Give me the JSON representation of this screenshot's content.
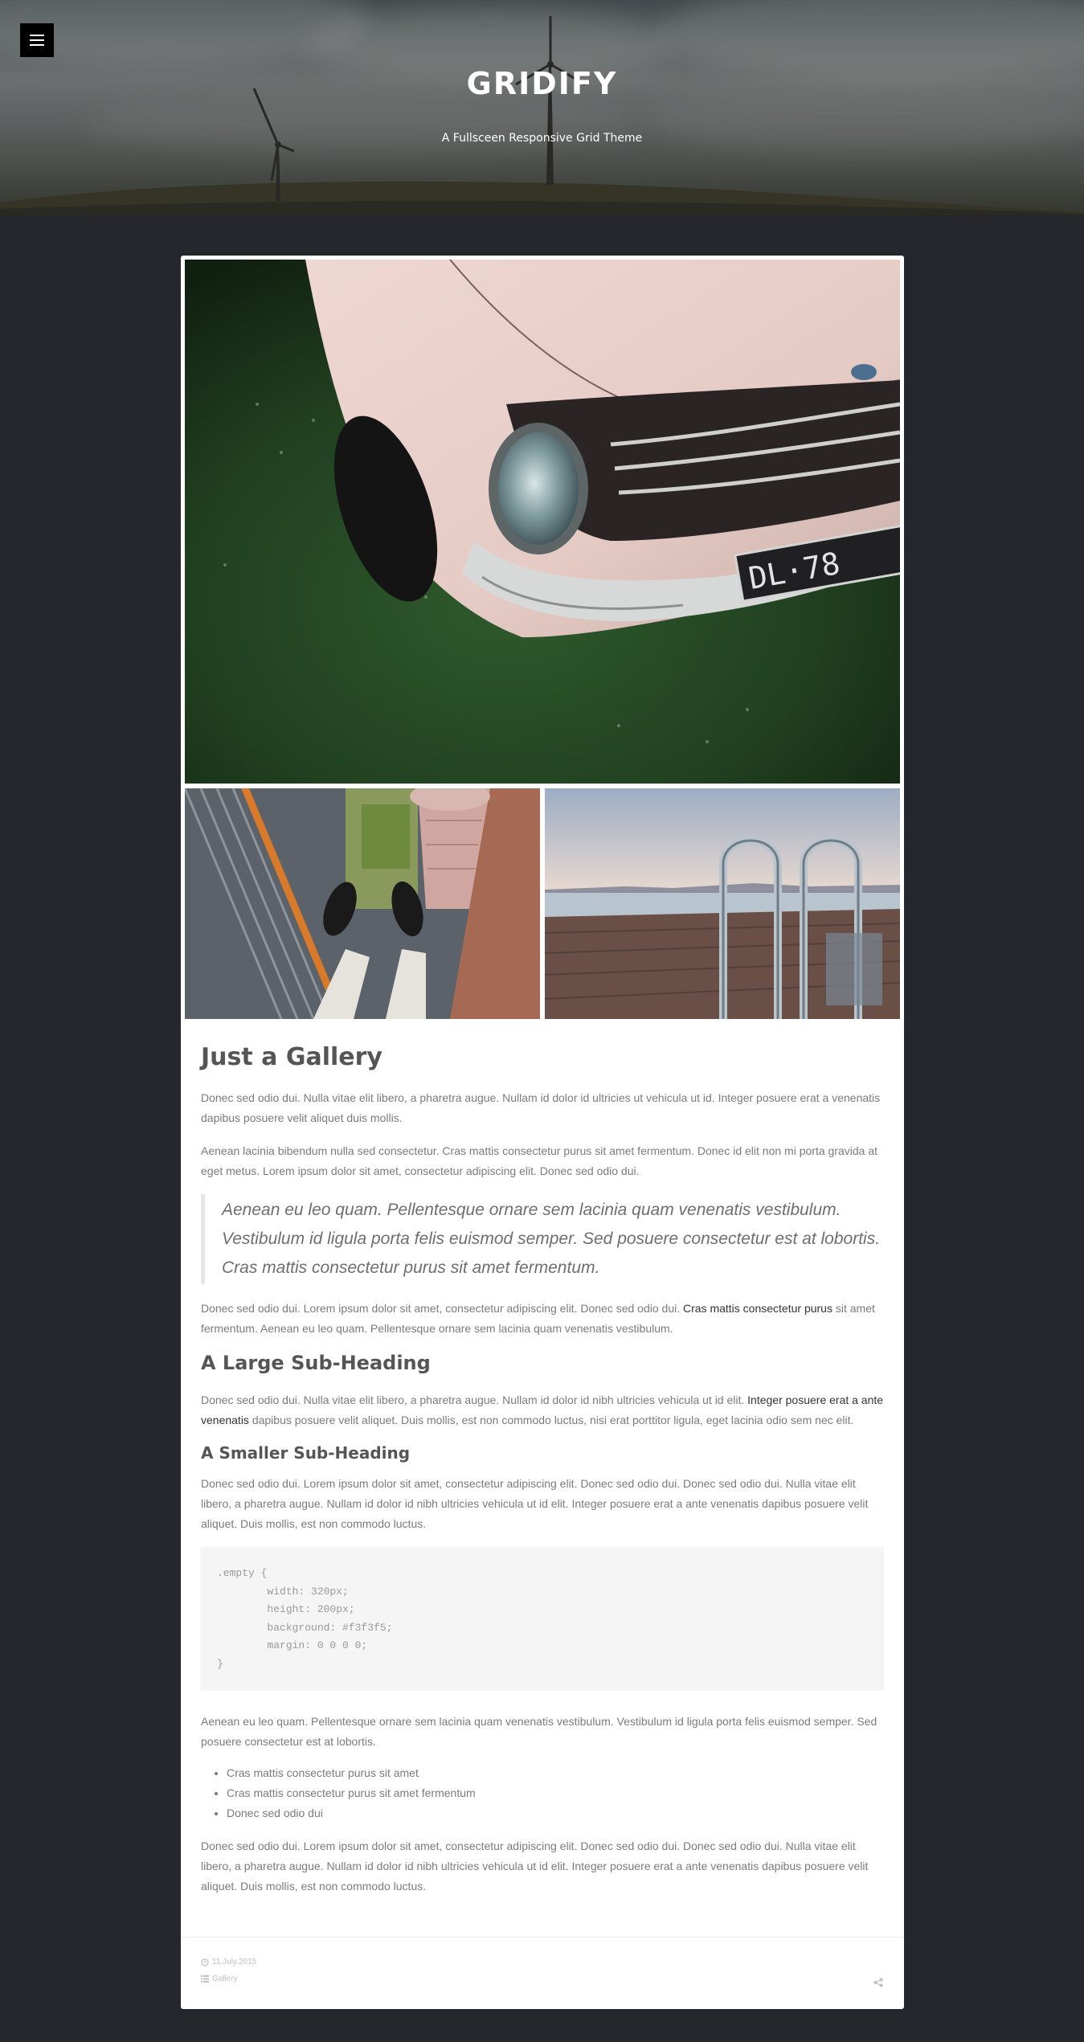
{
  "header": {
    "site_title": "GRIDIFY",
    "tagline": "A Fullsceen Responsive Grid Theme",
    "menu_icon": "hamburger-menu-icon"
  },
  "gallery": {
    "images": [
      {
        "name": "vintage-car-photo",
        "plate_text": "DL·78"
      },
      {
        "name": "city-rooftop-photo"
      },
      {
        "name": "dock-ladder-photo"
      }
    ]
  },
  "post": {
    "title": "Just a Gallery",
    "para1": "Donec sed odio dui. Nulla vitae elit libero, a pharetra augue. Nullam id dolor id ultricies ut vehicula ut id. Integer posuere erat a venenatis dapibus posuere velit aliquet duis mollis.",
    "para2": "Aenean lacinia bibendum nulla sed consectetur. Cras mattis consectetur purus sit amet fermentum. Donec id elit non mi porta gravida at eget metus. Lorem ipsum dolor sit amet, consectetur adipiscing elit. Donec sed odio dui.",
    "quote": "Aenean eu leo quam. Pellentesque ornare sem lacinia quam venenatis vestibulum. Vestibulum id ligula porta felis euismod semper. Sed posuere consectetur est at lobortis. Cras mattis consectetur purus sit amet fermentum.",
    "para3_before": "Donec sed odio dui. Lorem ipsum dolor sit amet, consectetur adipiscing elit. Donec sed odio dui. ",
    "para3_link": "Cras mattis consectetur purus",
    "para3_after": " sit amet fermentum. Aenean eu leo quam. Pellentesque ornare sem lacinia quam venenatis vestibulum.",
    "subheading_large": "A Large Sub-Heading",
    "para4_before": "Donec sed odio dui. Nulla vitae elit libero, a pharetra augue. Nullam id dolor id nibh ultricies vehicula ut id elit. ",
    "para4_link": "Integer posuere erat a ante venenatis",
    "para4_after": " dapibus posuere velit aliquet. Duis mollis, est non commodo luctus, nisi erat porttitor ligula, eget lacinia odio sem nec elit.",
    "subheading_small": "A Smaller Sub-Heading",
    "para5": "Donec sed odio dui. Lorem ipsum dolor sit amet, consectetur adipiscing elit. Donec sed odio dui. Donec sed odio dui. Nulla vitae elit libero, a pharetra augue. Nullam id dolor id nibh ultricies vehicula ut id elit. Integer posuere erat a ante venenatis dapibus posuere velit aliquet. Duis mollis, est non commodo luctus.",
    "code": ".empty {\n        width: 320px;\n        height: 200px;\n        background: #f3f3f5;\n        margin: 0 0 0 0;\n}",
    "para6": "Aenean eu leo quam. Pellentesque ornare sem lacinia quam venenatis vestibulum. Vestibulum id ligula porta felis euismod semper. Sed posuere consectetur est at lobortis.",
    "list": [
      "Cras mattis consectetur purus sit amet",
      "Cras mattis consectetur purus sit amet fermentum",
      "Donec sed odio dui"
    ],
    "para7": "Donec sed odio dui. Lorem ipsum dolor sit amet, consectetur adipiscing elit. Donec sed odio dui. Donec sed odio dui. Nulla vitae elit libero, a pharetra augue. Nullam id dolor id nibh ultricies vehicula ut id elit. Integer posuere erat a ante venenatis dapibus posuere velit aliquet. Duis mollis, est non commodo luctus."
  },
  "meta": {
    "date": "11.July.2015",
    "category": "Gallery",
    "date_icon": "clock-icon",
    "category_icon": "list-icon",
    "share_icon": "share-icon"
  },
  "colors": {
    "page_background": "#25272c",
    "card_background": "#ffffff",
    "heading": "#555555",
    "body_text": "#7b7b7b",
    "code_background": "#f5f5f5"
  }
}
